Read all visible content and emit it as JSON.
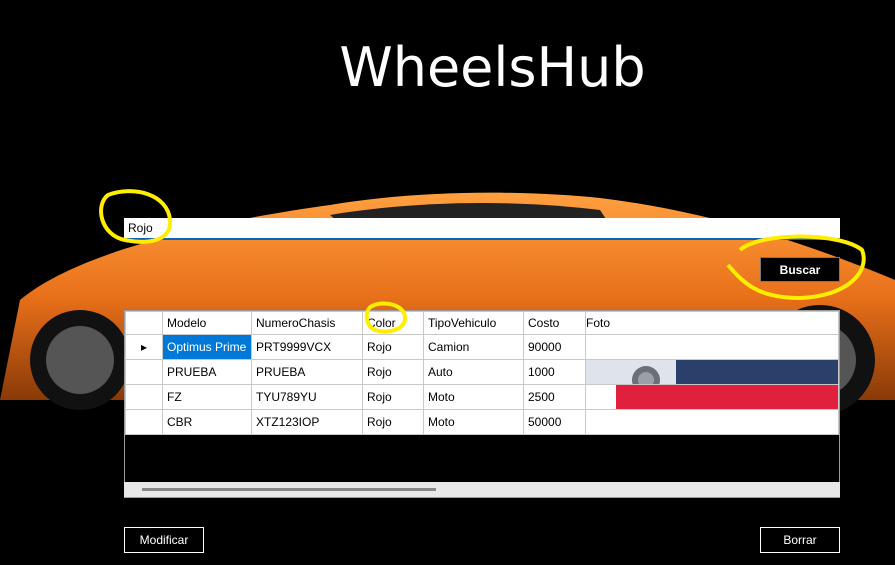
{
  "app": {
    "title": "WheelsHub"
  },
  "search": {
    "value": "Rojo",
    "button_label": "Buscar"
  },
  "grid": {
    "columns": [
      "Modelo",
      "NumeroChasis",
      "Color",
      "TipoVehiculo",
      "Costo",
      "Foto"
    ],
    "rows": [
      {
        "modelo": "Optimus Prime",
        "chasis": "PRT9999VCX",
        "color": "Rojo",
        "tipo": "Camion",
        "costo": "90000"
      },
      {
        "modelo": "PRUEBA",
        "chasis": "PRUEBA",
        "color": "Rojo",
        "tipo": "Auto",
        "costo": "1000"
      },
      {
        "modelo": "FZ",
        "chasis": "TYU789YU",
        "color": "Rojo",
        "tipo": "Moto",
        "costo": "2500"
      },
      {
        "modelo": "CBR",
        "chasis": "XTZ123IOP",
        "color": "Rojo",
        "tipo": "Moto",
        "costo": "50000"
      }
    ]
  },
  "actions": {
    "modify_label": "Modificar",
    "delete_label": "Borrar"
  },
  "colors": {
    "accent": "#0078d7",
    "highlight_annotation": "#ffee00",
    "car": "#f07a1a"
  }
}
